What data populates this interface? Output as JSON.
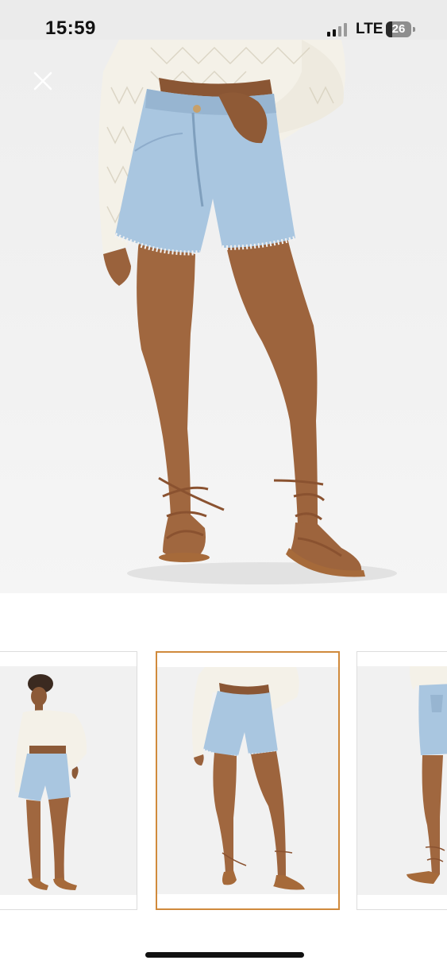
{
  "status_bar": {
    "time": "15:59",
    "network": "LTE",
    "battery_level": "26",
    "battery_fraction": 0.26
  },
  "icons": {
    "close": "close-icon",
    "signal": "signal-icon",
    "battery": "battery-icon"
  },
  "product": {
    "main_image_alt": "denim-shorts-front-view",
    "thumbnails": [
      {
        "id": "full-body-view",
        "selected": false
      },
      {
        "id": "front-close-view",
        "selected": true
      },
      {
        "id": "back-view",
        "selected": false
      }
    ]
  },
  "colors": {
    "accent_selected_border": "#d08a3c",
    "status_bar_bg": "#ebebeb",
    "denim": "#a9c6e0",
    "skin": "#a0673f"
  }
}
